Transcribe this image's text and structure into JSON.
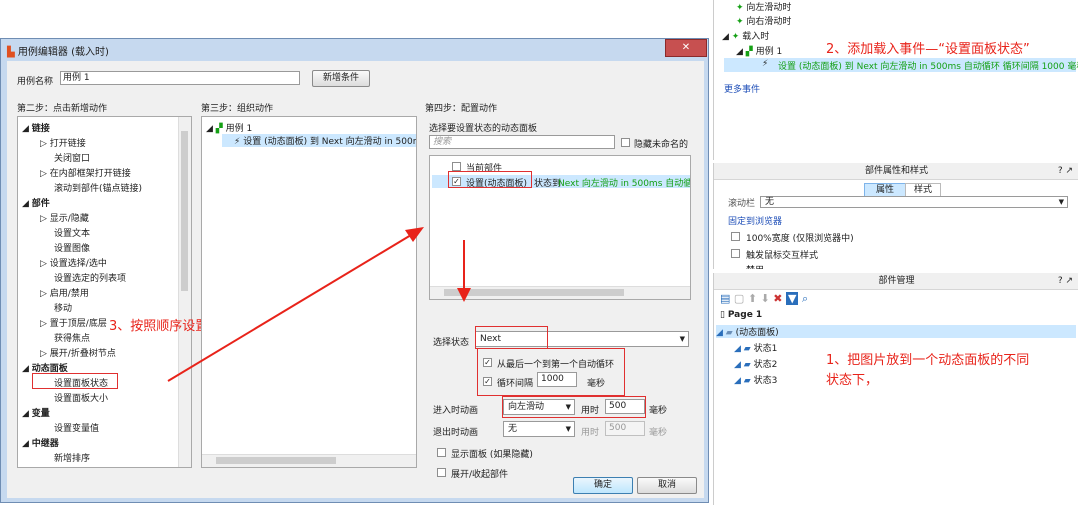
{
  "top_right_tree": {
    "items": [
      "向左滑动时",
      "向右滑动时",
      "载入时",
      "用例 1"
    ],
    "action_text": "设置 (动态面板) 到 Next 向左滑动 in 500ms 自动循环 循环间隔 1000 毫秒",
    "more_events": "更多事件"
  },
  "annotations": {
    "a1": "1、把图片放到一个动态面板的不同",
    "a1b": "状态下，",
    "a2": "2、添加载入事件—“设置面板状态”",
    "a3": "3、按照顺序设置"
  },
  "dialog": {
    "title": "用例编辑器 (载入时)",
    "case_name_label": "用例名称",
    "case_name_value": "用例 1",
    "add_condition": "新增条件",
    "step2": "第二步：点击新增动作",
    "step3": "第三步：组织动作",
    "step4": "第四步：配置动作",
    "actions": {
      "links": "链接",
      "open_link": "打开链接",
      "close_window": "关闭窗口",
      "open_in_frame": "在内部框架打开链接",
      "scroll_to": "滚动到部件(锚点链接)",
      "widgets": "部件",
      "show_hide": "显示/隐藏",
      "set_text": "设置文本",
      "set_image": "设置图像",
      "set_selected": "设置选择/选中",
      "set_list": "设置选定的列表项",
      "enable_disable": "启用/禁用",
      "move": "移动",
      "front_back": "置于顶层/底层",
      "focus": "获得焦点",
      "expand_collapse": "展开/折叠树节点",
      "dynamic_panel": "动态面板",
      "set_panel_state": "设置面板状态",
      "set_panel_size": "设置面板大小",
      "variables": "变量",
      "set_variable": "设置变量值",
      "repeater": "中继器",
      "add_sort": "新增排序"
    },
    "organize": {
      "case": "用例 1",
      "action": "设置 (动态面板) 到 Next 向左滑动 in 500ms"
    },
    "config": {
      "select_label": "选择要设置状态的动态面板",
      "search_placeholder": "搜索",
      "hide_unnamed": "隐藏未命名的",
      "current_widget": "当前部件",
      "panel_prefix": "设置(动态面板)",
      "panel_mid": "状态到",
      "panel_suffix": "Next 向左滑动 in 500ms 自动循环 循",
      "select_state_label": "选择状态",
      "select_state_value": "Next",
      "loop_from_last": "从最后一个到第一个自动循环",
      "loop_interval_label": "循环间隔",
      "loop_interval_value": "1000",
      "ms": "毫秒",
      "enter_anim_label": "进入时动画",
      "enter_anim_value": "向左滑动",
      "duration_label": "用时",
      "enter_duration": "500",
      "exit_anim_label": "退出时动画",
      "exit_anim_value": "无",
      "exit_duration": "500",
      "show_panel": "显示面板 (如果隐藏)",
      "expand_collapse": "展开/收起部件"
    },
    "ok": "确定",
    "cancel": "取消"
  },
  "properties": {
    "title": "部件属性和样式",
    "help": "? ↗",
    "tab_props": "属性",
    "tab_style": "样式",
    "scroll_label": "滚动栏",
    "scroll_value": "无",
    "pin": "固定到浏览器",
    "width100": "100%宽度 (仅限浏览器中)",
    "hover": "触发鼠标交互样式",
    "disabled": "禁用"
  },
  "manager": {
    "title": "部件管理",
    "help": "? ↗",
    "page": "Page 1",
    "panel": "(动态面板)",
    "states": [
      "状态1",
      "状态2",
      "状态3"
    ]
  },
  "colors": {
    "accent_red": "#e8231a",
    "green_text": "#15a015",
    "selection": "#cce8ff"
  }
}
